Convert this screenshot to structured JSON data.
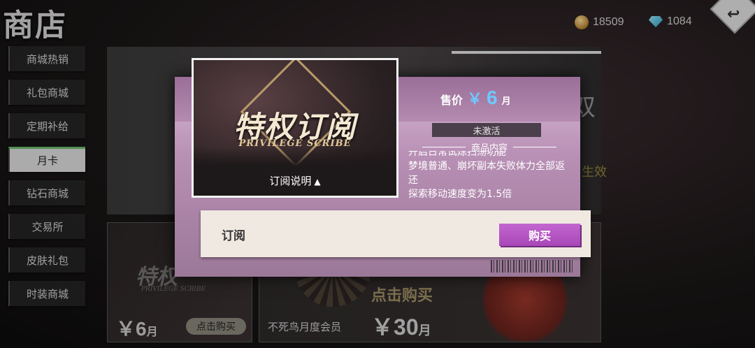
{
  "header": {
    "title": "商店",
    "gold_amount": "18509",
    "gem_amount": "1084"
  },
  "sidebar": {
    "items": [
      {
        "label": "商城热销",
        "active": false
      },
      {
        "label": "礼包商城",
        "active": false
      },
      {
        "label": "定期补给",
        "active": false
      },
      {
        "label": "月卡",
        "active": true
      },
      {
        "label": "钻石商城",
        "active": false
      },
      {
        "label": "交易所",
        "active": false
      },
      {
        "label": "皮肤礼包",
        "active": false
      },
      {
        "label": "时装商城",
        "active": false
      }
    ]
  },
  "background": {
    "card1": {
      "logo": "特权",
      "logo_sub": "PRIVILEGE SCRIBE",
      "price_symbol": "￥",
      "price_value": "6",
      "price_unit": "月",
      "button": "点击购买"
    },
    "card2": {
      "name": "不死鸟月度会员",
      "cta": "点击购买",
      "price_symbol": "￥",
      "price_value": "30",
      "price_unit": "月"
    },
    "right_text": "双",
    "right_text2": "生效"
  },
  "modal": {
    "card_title": "特权订阅",
    "card_subtitle": "PRIVILEGE SCRIBE",
    "help_label": "订阅说明",
    "price_label": "售价",
    "price_symbol": "￥",
    "price_value": "6",
    "price_unit": "月",
    "status": "未激活",
    "content_heading": "商品内容",
    "content_lines": [
      "开启日常试炼扫荡功能",
      "梦境普通、崩坏副本失败体力全部返还",
      "探索移动速度变为1.5倍"
    ],
    "subscribe_label": "订阅",
    "buy_label": "购买"
  },
  "colors": {
    "accent_blue": "#6fc8ff",
    "buy_purple": "#b650c4",
    "modal_bg": "#c19fbf"
  }
}
